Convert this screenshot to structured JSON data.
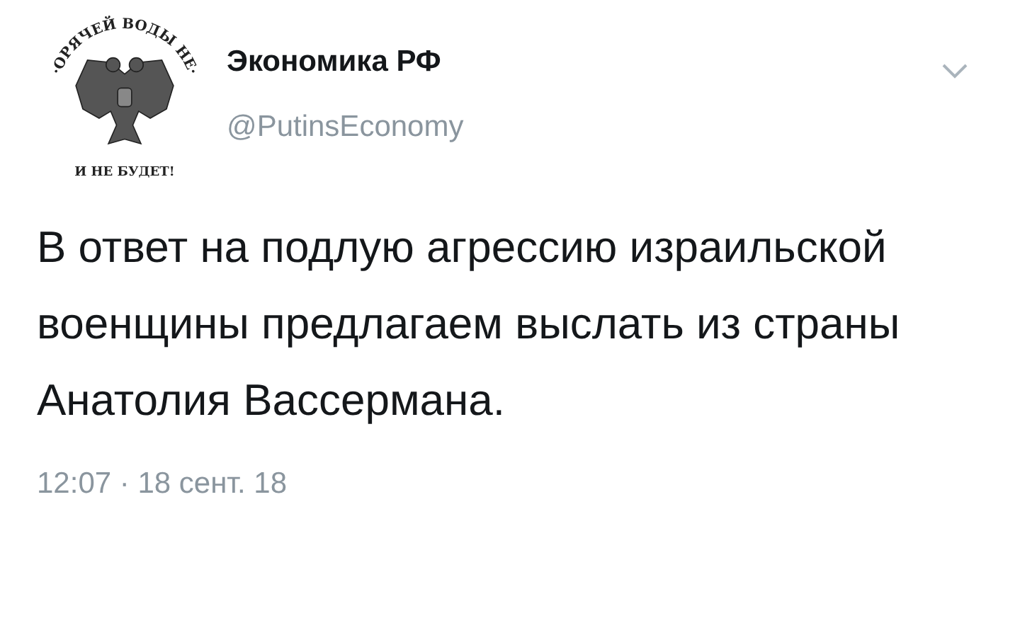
{
  "tweet": {
    "avatar": {
      "top_text": "·ОРЯЧЕЙ ВОДЫ НЕ·",
      "bottom_text": "И НЕ БУДЕТ!"
    },
    "author_name": "Экономика РФ",
    "handle": "@PutinsEconomy",
    "text": "В ответ на подлую агрессию израильской военщины предлагаем выслать из страны Анатолия Вассермана.",
    "timestamp": "12:07 · 18 сент. 18"
  }
}
